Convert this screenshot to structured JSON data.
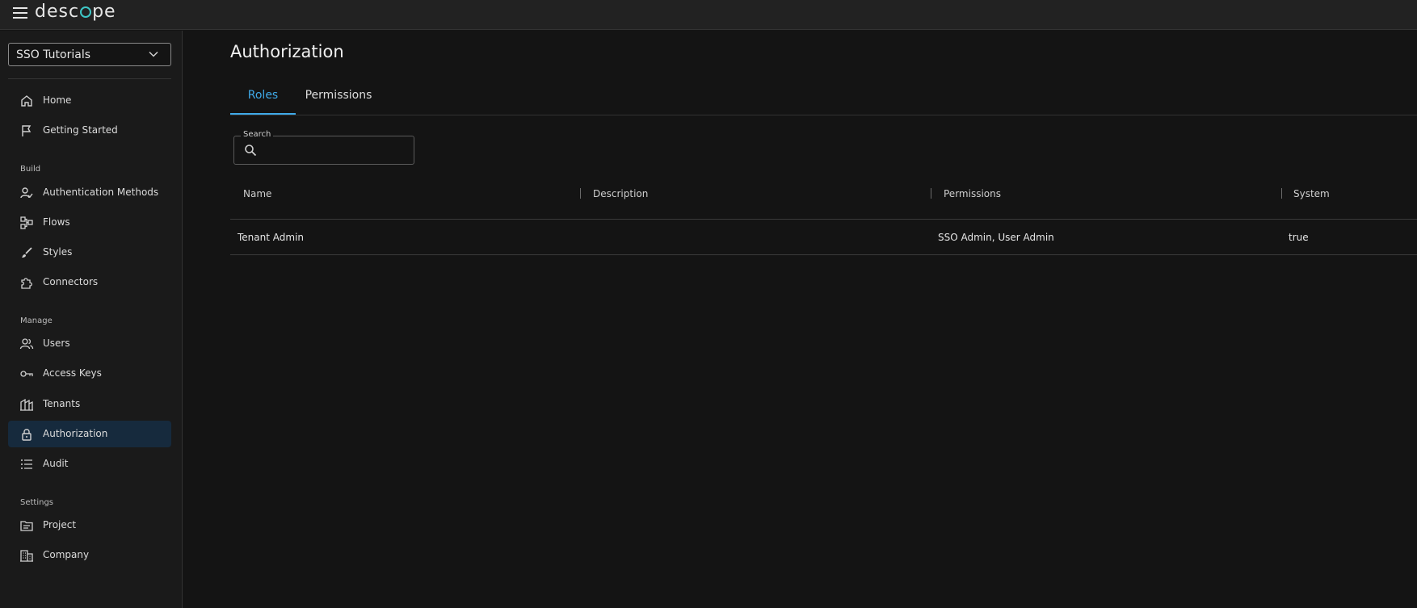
{
  "app": {
    "logo_text": "descope",
    "accent_color": "#3fa9e8"
  },
  "sidebar": {
    "project": "SSO Tutorials",
    "sections": {
      "build": "Build",
      "manage": "Manage",
      "settings": "Settings"
    },
    "items": [
      {
        "label": "Home",
        "icon": "home-icon"
      },
      {
        "label": "Getting Started",
        "icon": "flag-icon"
      },
      {
        "label": "Authentication Methods",
        "icon": "user-check-icon"
      },
      {
        "label": "Flows",
        "icon": "flows-icon"
      },
      {
        "label": "Styles",
        "icon": "brush-icon"
      },
      {
        "label": "Connectors",
        "icon": "puzzle-icon"
      },
      {
        "label": "Users",
        "icon": "users-icon"
      },
      {
        "label": "Access Keys",
        "icon": "key-icon"
      },
      {
        "label": "Tenants",
        "icon": "tenants-icon"
      },
      {
        "label": "Authorization",
        "icon": "lock-icon",
        "active": true
      },
      {
        "label": "Audit",
        "icon": "list-icon"
      },
      {
        "label": "Project",
        "icon": "folder-icon"
      },
      {
        "label": "Company",
        "icon": "building-icon"
      }
    ]
  },
  "main": {
    "title": "Authorization",
    "tabs": [
      {
        "label": "Roles",
        "active": true
      },
      {
        "label": "Permissions",
        "active": false
      }
    ],
    "search": {
      "label": "Search",
      "value": ""
    },
    "table": {
      "columns": [
        "Name",
        "Description",
        "Permissions",
        "System"
      ],
      "rows": [
        {
          "name": "Tenant Admin",
          "description": "",
          "permissions": "SSO Admin, User Admin",
          "system": "true"
        }
      ]
    }
  }
}
